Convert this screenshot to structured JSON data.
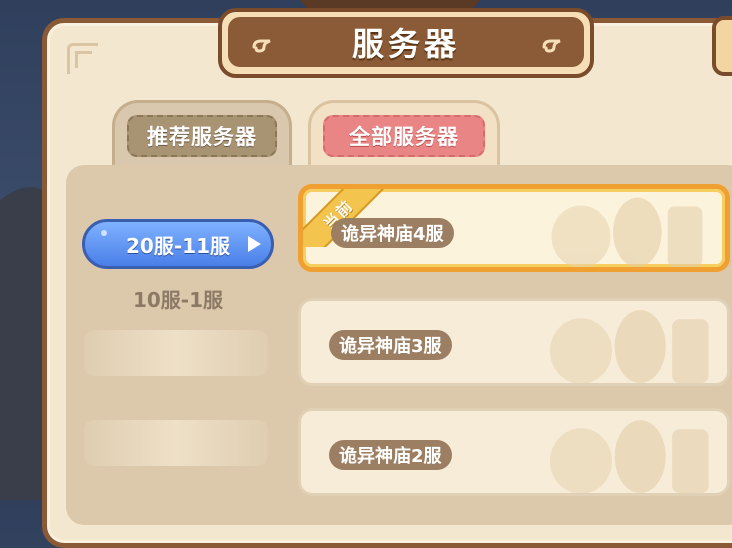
{
  "title": "服务器",
  "tabs": [
    {
      "label": "推荐服务器",
      "active": false
    },
    {
      "label": "全部服务器",
      "active": true
    }
  ],
  "ranges": [
    {
      "label": "20服-11服",
      "selected": true
    },
    {
      "label": "10服-1服",
      "selected": false
    }
  ],
  "servers": [
    {
      "name": "诡异神庙4服",
      "current": true,
      "badge": "当前"
    },
    {
      "name": "诡异神庙3服",
      "current": false
    },
    {
      "name": "诡异神庙2服",
      "current": false
    }
  ],
  "colors": {
    "accent_blue": "#4a7fe8",
    "current_border": "#f0a030",
    "tab_active": "#ea8585",
    "frame_brown": "#8b5a36"
  }
}
